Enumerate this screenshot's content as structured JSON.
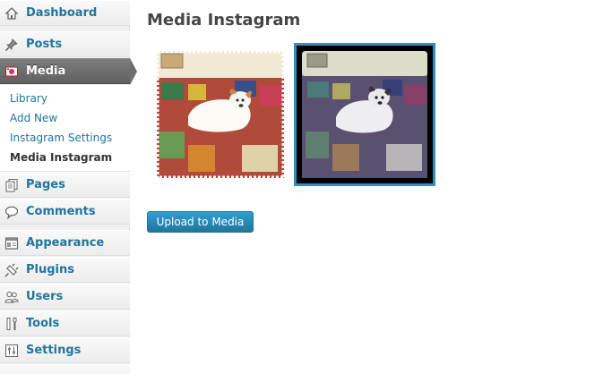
{
  "sidebar": {
    "items": [
      {
        "label": "Dashboard",
        "icon": "dashboard-icon"
      },
      {
        "label": "Posts",
        "icon": "pushpin-icon"
      },
      {
        "label": "Media",
        "icon": "media-icon",
        "active": true
      },
      {
        "label": "Pages",
        "icon": "pages-icon"
      },
      {
        "label": "Comments",
        "icon": "comment-bubble-icon"
      },
      {
        "label": "Appearance",
        "icon": "appearance-icon"
      },
      {
        "label": "Plugins",
        "icon": "plug-icon"
      },
      {
        "label": "Users",
        "icon": "users-icon"
      },
      {
        "label": "Tools",
        "icon": "tools-icon"
      },
      {
        "label": "Settings",
        "icon": "settings-icon"
      }
    ],
    "submenu": [
      {
        "label": "Library"
      },
      {
        "label": "Add New"
      },
      {
        "label": "Instagram Settings"
      },
      {
        "label": "Media Instagram",
        "current": true
      }
    ]
  },
  "main": {
    "title": "Media Instagram",
    "thumbnails": [
      {
        "name": "instagram-photo",
        "selected": false
      },
      {
        "name": "instagram-photo",
        "selected": true
      }
    ],
    "upload_button": "Upload to Media"
  },
  "colors": {
    "link": "#21759b",
    "active_menu": "#6e6e6e",
    "selected_border": "#2f8fc0",
    "button": "#21759b"
  }
}
